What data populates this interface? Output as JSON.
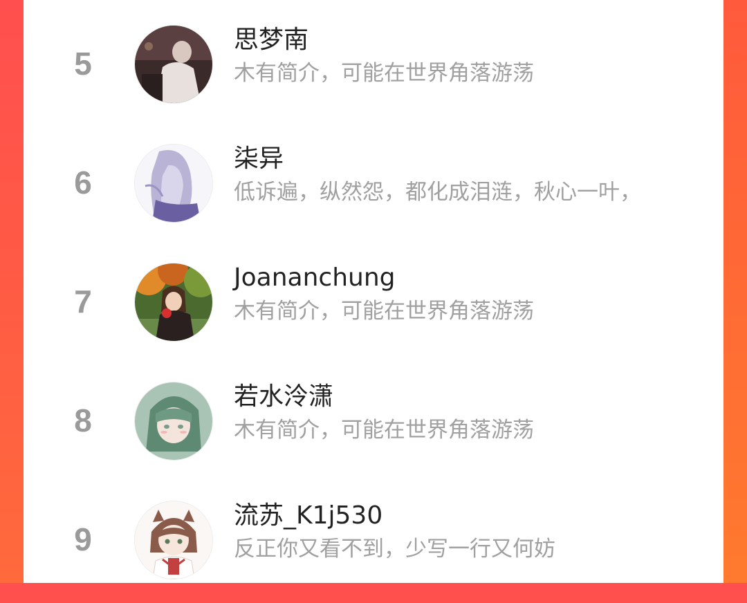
{
  "ranking": {
    "items": [
      {
        "rank": "5",
        "name": "思梦南",
        "bio": "木有简介，可能在世界角落游荡",
        "avatar_icon": "avatar-photo-icon"
      },
      {
        "rank": "6",
        "name": "柒异",
        "bio": "低诉遍，纵然怨，都化成泪涟，秋心一叶，",
        "avatar_icon": "avatar-illustration-icon"
      },
      {
        "rank": "7",
        "name": "Joananchung",
        "bio": "木有简介，可能在世界角落游荡",
        "avatar_icon": "avatar-photo-icon"
      },
      {
        "rank": "8",
        "name": "若水泠潇",
        "bio": "木有简介，可能在世界角落游荡",
        "avatar_icon": "avatar-illustration-icon"
      },
      {
        "rank": "9",
        "name": "流苏_K1j530",
        "bio": "反正你又看不到，少写一行又何妨",
        "avatar_icon": "avatar-illustration-icon"
      }
    ]
  },
  "colors": {
    "background_left": "#ff4f4f",
    "background_right": "#ff6a3c",
    "panel": "#ffffff",
    "rank_text": "#9a9a9a",
    "name_text": "#222222",
    "bio_text": "#a0a0a0"
  }
}
